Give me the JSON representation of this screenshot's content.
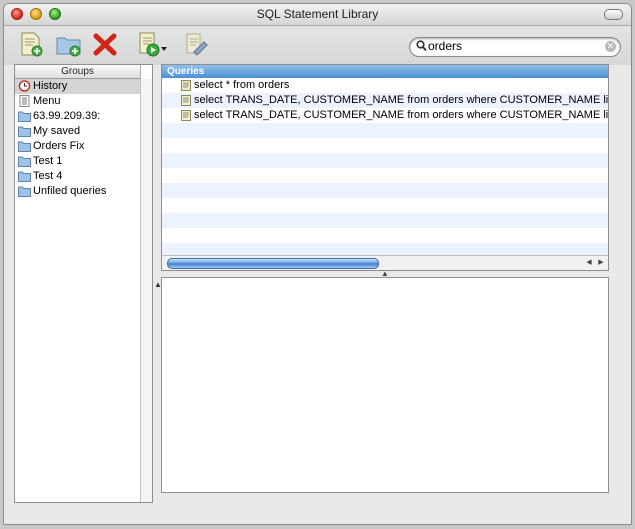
{
  "window": {
    "title": "SQL Statement Library"
  },
  "toolbar": {
    "buttons": [
      {
        "name": "new-query",
        "icon": "new-document-plus-icon"
      },
      {
        "name": "new-group",
        "icon": "new-folder-plus-icon"
      },
      {
        "name": "delete",
        "icon": "red-x-delete-icon"
      },
      {
        "name": "run-menu",
        "icon": "run-query-icon"
      },
      {
        "name": "edit",
        "icon": "edit-query-icon"
      }
    ]
  },
  "search": {
    "value": "orders",
    "placeholder": ""
  },
  "groups": {
    "header": "Groups",
    "items": [
      {
        "label": "History",
        "icon": "clock-icon",
        "selected": true
      },
      {
        "label": "Menu",
        "icon": "list-icon"
      },
      {
        "label": "63.99.209.39:",
        "icon": "folder-icon"
      },
      {
        "label": "My saved",
        "icon": "folder-icon"
      },
      {
        "label": "Orders Fix",
        "icon": "folder-icon"
      },
      {
        "label": "Test 1",
        "icon": "folder-icon"
      },
      {
        "label": "Test 4",
        "icon": "folder-icon"
      },
      {
        "label": "Unfiled queries",
        "icon": "folder-icon"
      }
    ]
  },
  "queries": {
    "header": "Queries",
    "rows": [
      "select * from orders",
      "select TRANS_DATE, CUSTOMER_NAME from orders where CUSTOMER_NAME like 'Bi",
      "select TRANS_DATE, CUSTOMER_NAME from orders where CUSTOMER_NAME like 'Bi"
    ]
  }
}
